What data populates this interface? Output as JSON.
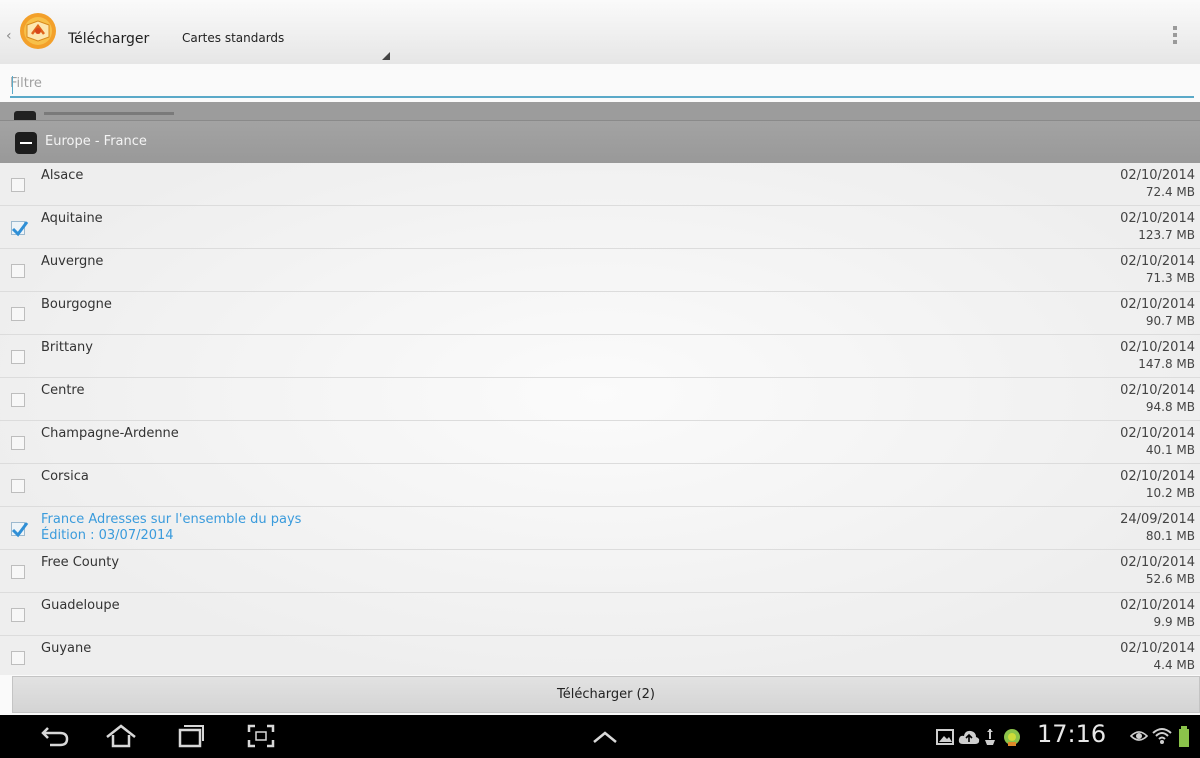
{
  "actionbar": {
    "title": "Télécharger",
    "spinner_value": "Cartes standards"
  },
  "filter": {
    "placeholder": "Filtre",
    "value": ""
  },
  "group": {
    "title": "Europe - France",
    "expanded": true
  },
  "items": [
    {
      "name": "Alsace",
      "date": "02/10/2014",
      "size": "72.4 MB",
      "checked": false
    },
    {
      "name": "Aquitaine",
      "date": "02/10/2014",
      "size": "123.7 MB",
      "checked": true
    },
    {
      "name": "Auvergne",
      "date": "02/10/2014",
      "size": "71.3 MB",
      "checked": false
    },
    {
      "name": "Bourgogne",
      "date": "02/10/2014",
      "size": "90.7 MB",
      "checked": false
    },
    {
      "name": "Brittany",
      "date": "02/10/2014",
      "size": "147.8 MB",
      "checked": false
    },
    {
      "name": "Centre",
      "date": "02/10/2014",
      "size": "94.8 MB",
      "checked": false
    },
    {
      "name": "Champagne-Ardenne",
      "date": "02/10/2014",
      "size": "40.1 MB",
      "checked": false
    },
    {
      "name": "Corsica",
      "date": "02/10/2014",
      "size": "10.2 MB",
      "checked": false
    },
    {
      "name": "France Adresses sur l'ensemble du pays",
      "subtitle": "Édition : 03/07/2014",
      "date": "24/09/2014",
      "size": "80.1 MB",
      "checked": true,
      "highlight": true
    },
    {
      "name": "Free County",
      "date": "02/10/2014",
      "size": "52.6 MB",
      "checked": false
    },
    {
      "name": "Guadeloupe",
      "date": "02/10/2014",
      "size": "9.9 MB",
      "checked": false
    },
    {
      "name": "Guyane",
      "date": "02/10/2014",
      "size": "4.4 MB",
      "checked": false
    }
  ],
  "download_button": {
    "label": "Télécharger (2)"
  },
  "statusbar": {
    "time": "17:16"
  },
  "colors": {
    "accent": "#3a9bdc",
    "filter_underline": "#5aa9c8",
    "group_header": "#9c9c9c",
    "navbar": "#000000"
  },
  "icons": {
    "back": "back-arrow-icon",
    "home": "home-icon",
    "recents": "recent-apps-icon",
    "screenshot": "screenshot-icon",
    "expand": "chevron-up-icon",
    "status": [
      "gallery-icon",
      "cloud-upload-icon",
      "usb-icon",
      "android-icon",
      "eye-icon",
      "wifi-icon",
      "battery-icon"
    ]
  }
}
